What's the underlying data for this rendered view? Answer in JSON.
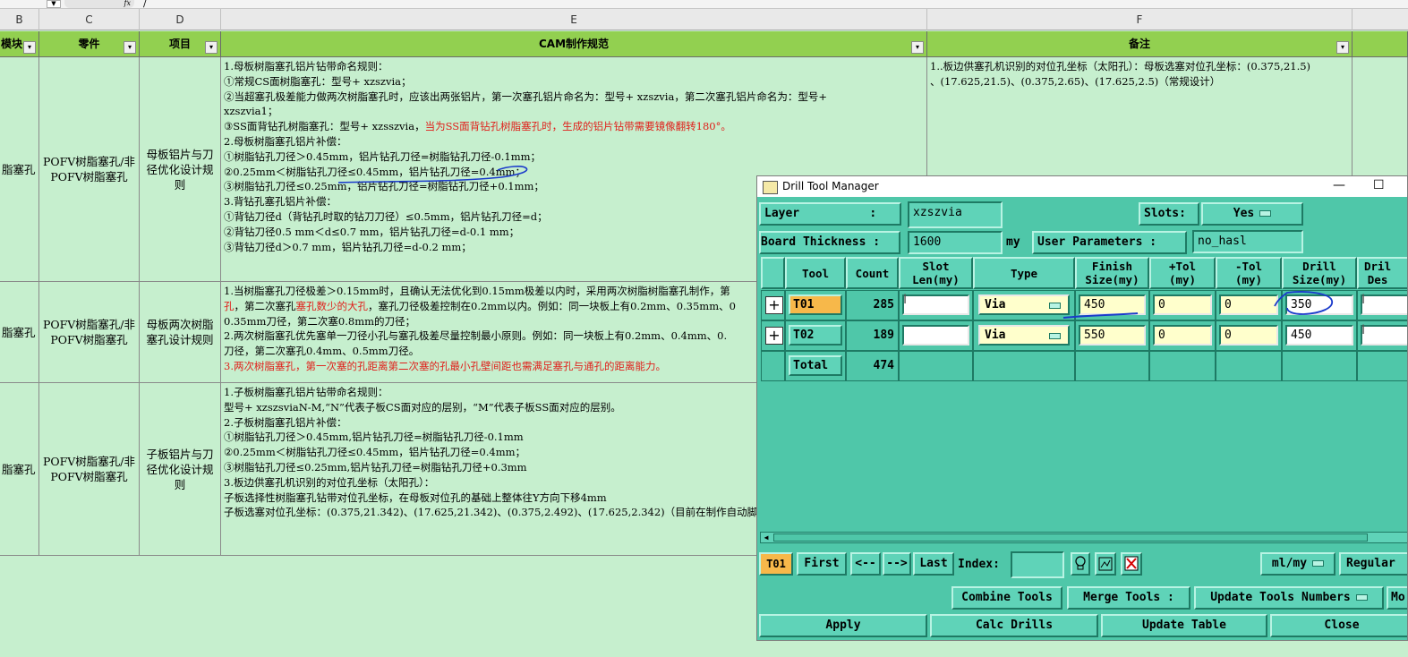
{
  "formula_bar": {
    "name_box_value": "",
    "fx_label": "fx",
    "content": "/"
  },
  "columns": {
    "b": "B",
    "c": "C",
    "d": "D",
    "e": "E",
    "f": "F"
  },
  "headers": {
    "module": "模块",
    "part": "零件",
    "item": "项目",
    "spec": "CAM制作规范",
    "remark": "备注",
    "dropdown_glyph": "▾"
  },
  "rows": [
    {
      "module": "脂塞孔",
      "part": "POFV树脂塞孔/非POFV树脂塞孔",
      "item": "母板铝片与刀径优化设计规则",
      "spec_lines": [
        "1.母板树脂塞孔铝片钻带命名规则：",
        "①常规CS面树脂塞孔：型号+ xzszvia；",
        "②当超塞孔极差能力做两次树脂塞孔时，应该出两张铝片，第一次塞孔铝片命名为：型号+ xzszvia，第二次塞孔铝片命名为：型号+",
        "xzszvia1；",
        "③SS面背钻孔树脂塞孔：型号+ xzsszvia，",
        "2.母板树脂塞孔铝片补偿：",
        "①树脂钻孔刀径＞0.45mm，铝片钻孔刀径=树脂钻孔刀径-0.1mm；",
        "②0.25mm＜树脂钻孔刀径≤0.45mm，铝片钻孔刀径=0.4mm；",
        "③树脂钻孔刀径≤0.25mm，铝片钻孔刀径=树脂钻孔刀径+0.1mm；",
        "3.背钻孔塞孔铝片补偿：",
        "①背钻刀径d（背钻孔时取的钻刀刀径）≤0.5mm，铝片钻孔刀径=d；",
        "②背钻刀径0.5 mm＜d≤0.7 mm，铝片钻孔刀径=d-0.1 mm；",
        "③背钻刀径d＞0.7 mm，铝片钻孔刀径=d-0.2 mm；"
      ],
      "spec_red_suffix": "当为SS面背钻孔树脂塞孔时，生成的铝片钻带需要镜像翻转180°。",
      "remark_lines": [
        "1..板边供塞孔机识别的对位孔坐标（太阳孔）：母板选塞对位孔坐标：(0.375,21.5)",
        "、(17.625,21.5)、(0.375,2.65)、(17.625,2.5)（常规设计）"
      ]
    },
    {
      "module": "脂塞孔",
      "part": "POFV树脂塞孔/非POFV树脂塞孔",
      "item": "母板两次树脂塞孔设计规则",
      "spec_line1": "1.当树脂塞孔刀径极差＞0.15mm时，且确认无法优化到0.15mm极差以内时，采用两次树脂树脂塞孔制作，第",
      "spec_line2_red1": "孔",
      "spec_line2_mid": "，第二次塞孔",
      "spec_line2_red2": "塞孔数少的大孔",
      "spec_line2_rest": "，塞孔刀径极差控制在0.2mm以内。例如：同一块板上有0.2mm、0.35mm、0",
      "spec_line3": "0.35mm刀径，第二次塞0.8mm的刀径；",
      "spec_line4": "2.两次树脂塞孔优先塞单一刀径小孔与塞孔极差尽量控制最小原则。例如：同一块板上有0.2mm、0.4mm、0.",
      "spec_line5": "刀径，第二次塞孔0.4mm、0.5mm刀径。",
      "spec_line6_red": "3.两次树脂塞孔，第一次塞的孔距离第二次塞的孔最小孔壁间距也需满足塞孔与通孔的距离能力。"
    },
    {
      "module": "脂塞孔",
      "part": "POFV树脂塞孔/非POFV树脂塞孔",
      "item": "子板铝片与刀径优化设计规则",
      "spec_lines": [
        "1.子板树脂塞孔铝片钻带命名规则：",
        "型号+ xzszsviaN-M,“N”代表子板CS面对应的层别，“M”代表子板SS面对应的层别。",
        "2.子板树脂塞孔铝片补偿：",
        "①树脂钻孔刀径＞0.45mm,铝片钻孔刀径=树脂钻孔刀径-0.1mm",
        "②0.25mm＜树脂钻孔刀径≤0.45mm，铝片钻孔刀径=0.4mm；",
        "③树脂钻孔刀径≤0.25mm,铝片钻孔刀径=树脂钻孔刀径+0.3mm",
        "3.板边供塞孔机识别的对位孔坐标（太阳孔）：",
        "子板选择性树脂塞孔钻带对位孔坐标，在母板对位孔的基础上整体往Y方向下移4mm",
        "子板选塞对位孔坐标：(0.375,21.342)、(17.625,21.342)、(0.375,2.492)、(17.625,2.342)（目前在制作自动脚本）"
      ]
    }
  ],
  "window": {
    "title": "Drill Tool Manager",
    "minimize": "—",
    "maximize": "☐",
    "layer_label": "Layer          :",
    "layer_value": "xzszvia",
    "slots_label": "Slots:",
    "slots_value": "Yes",
    "board_thickness_label": "Board Thickness :",
    "board_thickness_value": "1600",
    "board_thickness_unit": "my",
    "user_params_label": "User Parameters :",
    "user_params_value": "no_hasl",
    "columns": {
      "tool": "Tool",
      "count": "Count",
      "slot_len": "Slot\nLen(my)",
      "type": "Type",
      "finish_size": "Finish\nSize(my)",
      "plus_tol": "+Tol\n(my)",
      "minus_tol": "-Tol\n(my)",
      "drill_size": "Drill\nSize(my)",
      "drill_des": "Dril\nDes"
    },
    "tools": [
      {
        "tool": "T01",
        "count": "285",
        "slot_len": "",
        "type": "Via",
        "finish_size": "450",
        "plus_tol": "0",
        "minus_tol": "0",
        "drill_size": "350"
      },
      {
        "tool": "T02",
        "count": "189",
        "slot_len": "",
        "type": "Via",
        "finish_size": "550",
        "plus_tol": "0",
        "minus_tol": "0",
        "drill_size": "450"
      }
    ],
    "total_label": "Total",
    "total_count": "474",
    "current_tool": "T01",
    "nav": {
      "first": "First",
      "prev": "<--",
      "next": "-->",
      "last": "Last",
      "index_label": "Index:"
    },
    "units": "ml/my",
    "mode": "Regular",
    "combine_tools": "Combine Tools",
    "merge_tools": "Merge Tools :",
    "update_tools_numbers": "Update Tools Numbers",
    "more": "Mo",
    "apply": "Apply",
    "calc_drills": "Calc Drills",
    "update_table": "Update Table",
    "close": "Close"
  }
}
